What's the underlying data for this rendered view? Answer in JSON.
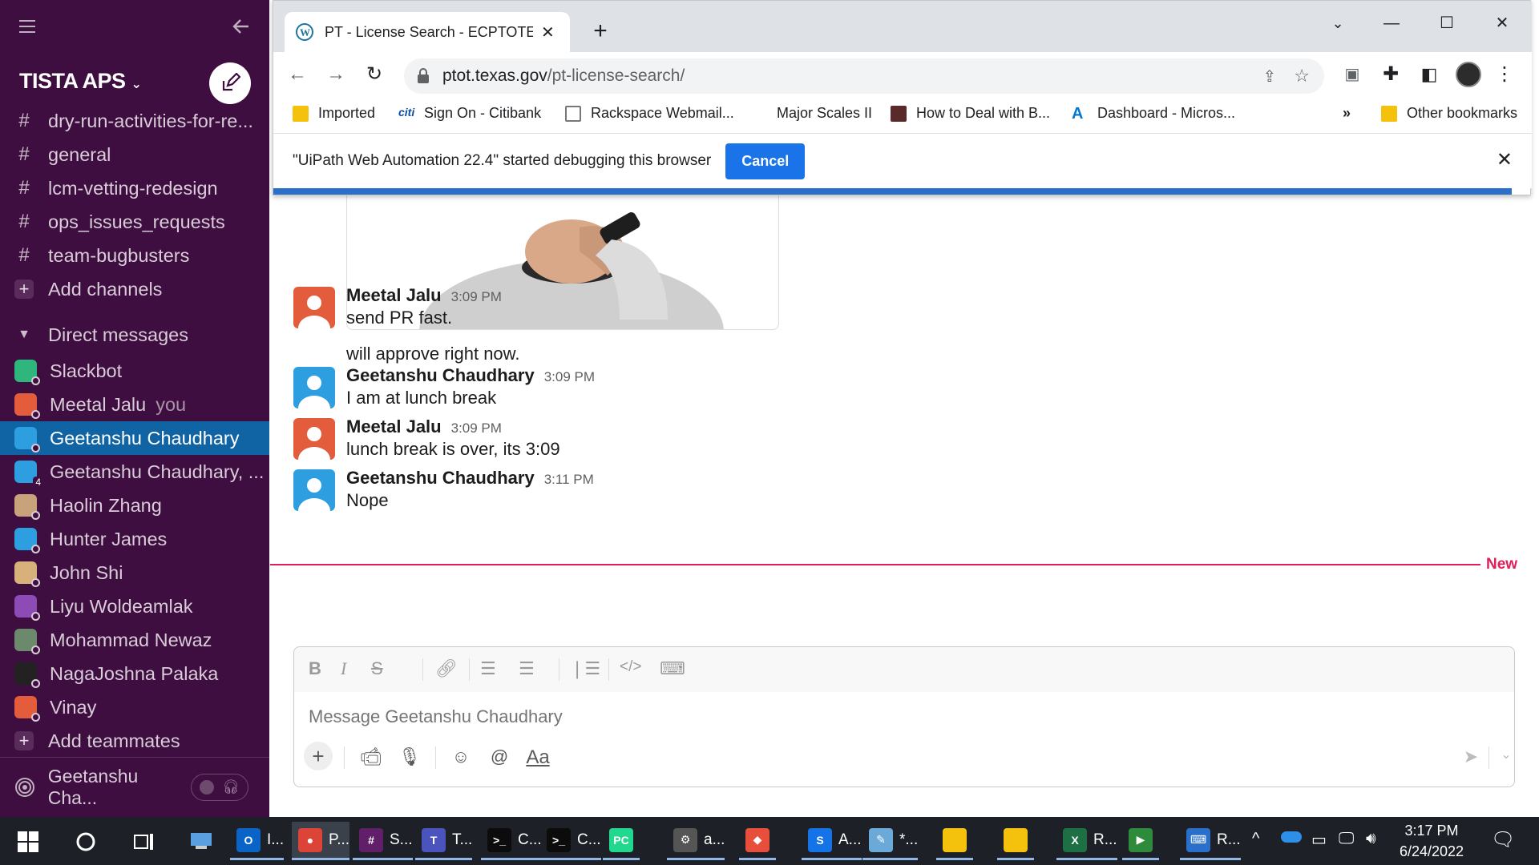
{
  "slack": {
    "workspace": "TISTA APS",
    "channels": [
      {
        "name": "dry-run-activities-for-re..."
      },
      {
        "name": "general"
      },
      {
        "name": "lcm-vetting-redesign"
      },
      {
        "name": "ops_issues_requests"
      },
      {
        "name": "team-bugbusters"
      }
    ],
    "add_channels": "Add channels",
    "dm_header": "Direct messages",
    "dms": [
      {
        "name": "Slackbot",
        "color": "#2eb67d"
      },
      {
        "name": "Meetal Jalu",
        "suffix": "you",
        "color": "#e35c3c"
      },
      {
        "name": "Geetanshu Chaudhary",
        "color": "#2d9ee0",
        "active": true
      },
      {
        "name": "Geetanshu Chaudhary, ...",
        "badge": "4",
        "color": "#2d9ee0"
      },
      {
        "name": "Haolin Zhang",
        "color": "#c8a27a"
      },
      {
        "name": "Hunter James",
        "color": "#2d9ee0"
      },
      {
        "name": "John Shi",
        "color": "#d8b07a"
      },
      {
        "name": "Liyu Woldeamlak",
        "color": "#8d4bb5"
      },
      {
        "name": "Mohammad Newaz",
        "color": "#6b8a6b"
      },
      {
        "name": "NagaJoshna Palaka",
        "color": "#222222"
      },
      {
        "name": "Vinay",
        "color": "#e35c3c"
      }
    ],
    "add_teammates": "Add teammates",
    "huddle_user": "Geetanshu Cha...",
    "messages": [
      {
        "author": "Meetal Jalu",
        "time": "3:09 PM",
        "lines": [
          "send PR fast.",
          "will approve right now."
        ],
        "avatar_color": "#e35c3c"
      },
      {
        "author": "Geetanshu Chaudhary",
        "time": "3:09 PM",
        "lines": [
          "I am at lunch break"
        ],
        "avatar_color": "#2d9ee0"
      },
      {
        "author": "Meetal Jalu",
        "time": "3:09 PM",
        "lines": [
          "lunch break is over, its 3:09"
        ],
        "avatar_color": "#e35c3c"
      },
      {
        "author": "Geetanshu Chaudhary",
        "time": "3:11 PM",
        "lines": [
          "Nope"
        ],
        "avatar_color": "#2d9ee0"
      }
    ],
    "new_label": "New",
    "composer_placeholder": "Message Geetanshu Chaudhary",
    "composer_font_label": "Aa"
  },
  "browser": {
    "tab_title": "PT - License Search - ECPTOTE W",
    "url_host": "ptot.texas.gov",
    "url_path": "/pt-license-search/",
    "bookmarks": [
      {
        "label": "Imported",
        "icon": "folder-icon"
      },
      {
        "label": "Sign On - Citibank",
        "icon": "citi-icon"
      },
      {
        "label": "Rackspace Webmail...",
        "icon": "mail-icon"
      },
      {
        "label": "Major Scales II",
        "icon": "none"
      },
      {
        "label": "How to Deal with B...",
        "icon": "site-icon"
      },
      {
        "label": "Dashboard - Micros...",
        "icon": "azure-icon"
      }
    ],
    "more_bookmarks": "»",
    "other_bookmarks": "Other bookmarks",
    "infobar_text": "\"UiPath Web Automation 22.4\" started debugging this browser",
    "infobar_button": "Cancel"
  },
  "taskbar": {
    "apps": [
      {
        "label": "I...",
        "color": "#0a64c8",
        "glyph": "O"
      },
      {
        "label": "P...",
        "color": "#db4437",
        "glyph": "●"
      },
      {
        "label": "S...",
        "color": "#611f69",
        "glyph": "#"
      },
      {
        "label": "T...",
        "color": "#4b53bc",
        "glyph": "T"
      },
      {
        "label": "C...",
        "color": "#0c0c0c",
        "glyph": ">_"
      },
      {
        "label": "C...",
        "color": "#0c0c0c",
        "glyph": ">_"
      },
      {
        "label": "",
        "color": "#22d88f",
        "glyph": "PC"
      },
      {
        "label": "a...",
        "color": "#555555",
        "glyph": "⚙"
      },
      {
        "label": "",
        "color": "#e84e3c",
        "glyph": "◆"
      },
      {
        "label": "A...",
        "color": "#1473e6",
        "glyph": "S"
      },
      {
        "label": "*...",
        "color": "#6aa9d8",
        "glyph": "✎"
      },
      {
        "label": "",
        "color": "#f4c20d",
        "glyph": ""
      },
      {
        "label": "",
        "color": "#f4c20d",
        "glyph": ""
      },
      {
        "label": "R...",
        "color": "#1d7044",
        "glyph": "X"
      },
      {
        "label": "",
        "color": "#2e8b3b",
        "glyph": "▶"
      },
      {
        "label": "R...",
        "color": "#2a6fc9",
        "glyph": "⌨"
      }
    ],
    "time": "3:17 PM",
    "date": "6/24/2022"
  }
}
